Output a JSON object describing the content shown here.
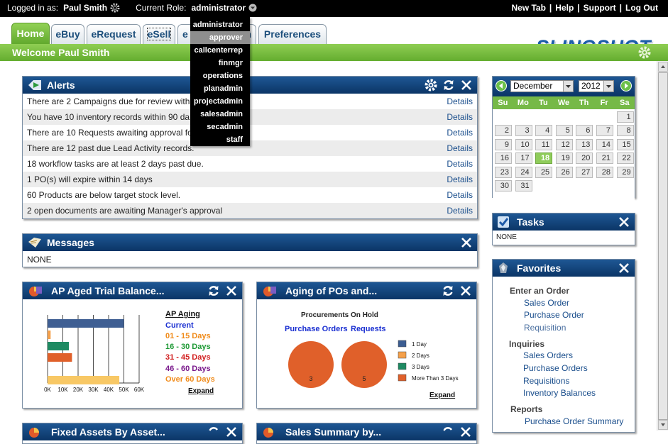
{
  "topbar": {
    "logged_in_label": "Logged in as:",
    "user_name": "Paul Smith",
    "role_label": "Current Role:",
    "role_value": "administrator",
    "links": [
      "New Tab",
      "Help",
      "Support",
      "Log Out"
    ]
  },
  "role_menu": {
    "options": [
      "administrator",
      "approver",
      "callcenterrep",
      "finmgr",
      "operations",
      "planadmin",
      "projectadmin",
      "salesadmin",
      "secadmin",
      "staff"
    ],
    "highlighted": "approver"
  },
  "tabs": [
    "Home",
    "eBuy",
    "eRequest",
    "eSell",
    "e",
    "n",
    "Preferences"
  ],
  "logo_text": "SLINGSHOT",
  "welcome": {
    "title": "Welcome Paul Smith"
  },
  "alerts": {
    "title": "Alerts",
    "details_label": "Details",
    "rows": [
      "There are 2 Campaigns due for review with",
      "You have 10 inventory records within 90 da",
      "There are 10 Requests awaiting approval fo",
      "There are 12 past due Lead Activity records.",
      "18 workflow tasks are at least 2 days past due.",
      "1 PO(s) will expire within 14 days",
      "60 Products are below target stock level.",
      "2 open documents are awaiting Manager's approval"
    ]
  },
  "messages": {
    "title": "Messages",
    "body": "NONE"
  },
  "ap_aging": {
    "title": "AP Aged Trial Balance...",
    "legend_title": "AP Aging",
    "legend": [
      {
        "label": "Current",
        "color": "#1a2fd1"
      },
      {
        "label": "01 - 15 Days",
        "color": "#f08b1a"
      },
      {
        "label": "16 - 30 Days",
        "color": "#1f9a36"
      },
      {
        "label": "31 - 45 Days",
        "color": "#d11f1f"
      },
      {
        "label": "46 - 60 Days",
        "color": "#7a1a8c"
      },
      {
        "label": "Over 60 Days",
        "color": "#f08b1a"
      }
    ],
    "expand_label": "Expand"
  },
  "chart_data": [
    {
      "type": "bar",
      "orientation": "horizontal",
      "categories": [
        "Current",
        "01 - 15 Days",
        "16 - 30 Days",
        "31 - 45 Days",
        "46 - 60 Days",
        "Over 60 Days"
      ],
      "values": [
        50000,
        2000,
        14000,
        16000,
        0,
        47000
      ],
      "colors": [
        "#3f5f93",
        "#f5a04a",
        "#1e8a62",
        "#e0602a",
        "#7a4a9a",
        "#f8c865"
      ],
      "xticks": [
        "0K",
        "10K",
        "20K",
        "30K",
        "40K",
        "50K",
        "60K"
      ],
      "xlim": [
        0,
        60000
      ],
      "grid": true
    },
    {
      "type": "pie",
      "title": "Procurements On Hold",
      "pies": [
        {
          "name": "Purchase Orders",
          "slices": [
            {
              "label": "More Than 3 Days",
              "value": 3
            }
          ]
        },
        {
          "name": "Requests",
          "slices": [
            {
              "label": "More Than 3 Days",
              "value": 5
            }
          ]
        }
      ],
      "legend": [
        {
          "label": "1 Day",
          "color": "#3b5d91"
        },
        {
          "label": "2 Days",
          "color": "#f5a04a"
        },
        {
          "label": "3 Days",
          "color": "#1e8a62"
        },
        {
          "label": "More Than 3 Days",
          "color": "#e0602a"
        }
      ]
    }
  ],
  "aging_pos": {
    "title": "Aging of POs and...",
    "expand_label": "Expand"
  },
  "bottom_widgets": [
    "Fixed Assets By Asset...",
    "Sales Summary by..."
  ],
  "calendar": {
    "month": "December",
    "year": "2012",
    "dow": [
      "Su",
      "Mo",
      "Tu",
      "We",
      "Th",
      "Fr",
      "Sa"
    ],
    "days": [
      "1",
      "2",
      "3",
      "4",
      "5",
      "6",
      "7",
      "8",
      "9",
      "10",
      "11",
      "12",
      "13",
      "14",
      "15",
      "16",
      "17",
      "18",
      "19",
      "20",
      "21",
      "22",
      "23",
      "24",
      "25",
      "26",
      "27",
      "28",
      "29",
      "30",
      "31"
    ],
    "today": "18"
  },
  "tasks": {
    "title": "Tasks",
    "body": "NONE"
  },
  "favorites": {
    "title": "Favorites",
    "sections": [
      {
        "label": "Enter an Order",
        "items": [
          "Sales Order",
          "Purchase Order",
          "Requisition"
        ]
      },
      {
        "label": "Inquiries",
        "items": [
          "Sales Orders",
          "Purchase Orders",
          "Requisitions",
          "Inventory Balances"
        ]
      },
      {
        "label": "Reports",
        "items": [
          "Purchase Order Summary"
        ]
      }
    ]
  }
}
